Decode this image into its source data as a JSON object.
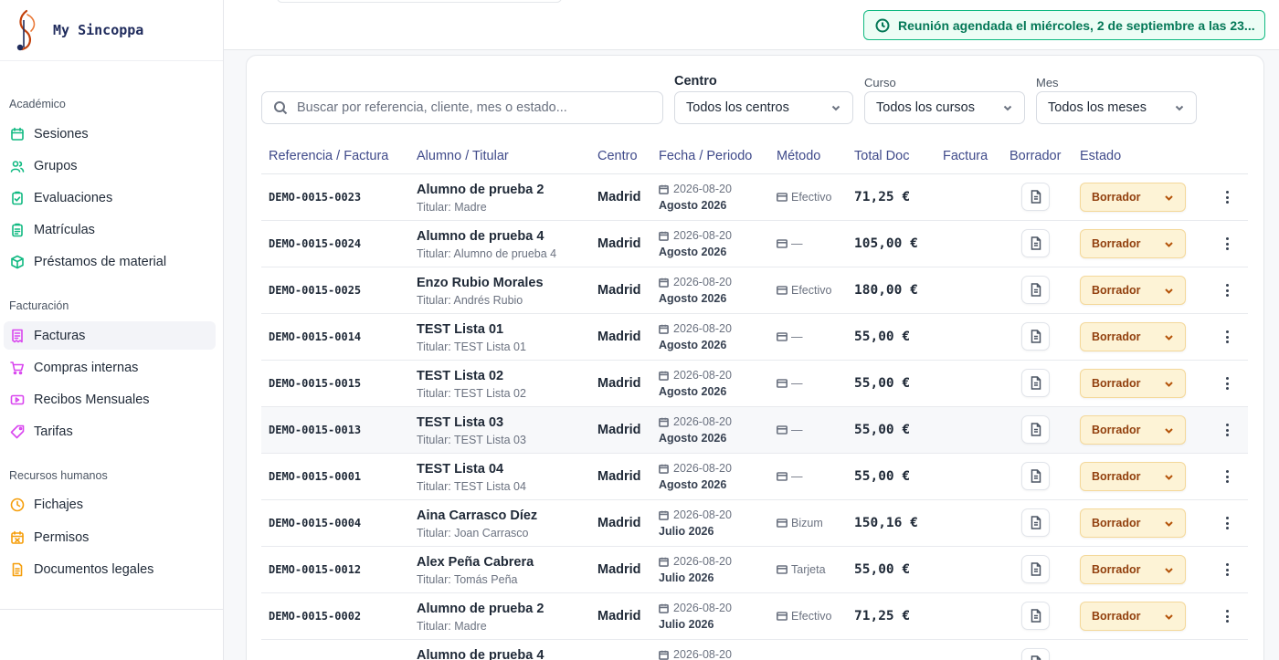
{
  "app": {
    "name": "My Sincoppa"
  },
  "sidebar": {
    "sections": [
      {
        "title": "Académico",
        "items": [
          {
            "label": "Sesiones",
            "icon": "calendar-icon",
            "color": "#10b981"
          },
          {
            "label": "Grupos",
            "icon": "users-icon",
            "color": "#10b981"
          },
          {
            "label": "Evaluaciones",
            "icon": "clipboard-check-icon",
            "color": "#10b981"
          },
          {
            "label": "Matrículas",
            "icon": "clipboard-list-icon",
            "color": "#10b981"
          },
          {
            "label": "Préstamos de material",
            "icon": "package-icon",
            "color": "#10b981"
          }
        ]
      },
      {
        "title": "Facturación",
        "items": [
          {
            "label": "Facturas",
            "icon": "invoice-icon",
            "color": "#d946ef",
            "active": true
          },
          {
            "label": "Compras internas",
            "icon": "cart-icon",
            "color": "#d946ef"
          },
          {
            "label": "Recibos Mensuales",
            "icon": "receipt-icon",
            "color": "#d946ef"
          },
          {
            "label": "Tarifas",
            "icon": "tag-icon",
            "color": "#d946ef"
          }
        ]
      },
      {
        "title": "Recursos humanos",
        "items": [
          {
            "label": "Fichajes",
            "icon": "clock-icon",
            "color": "#f59e0b"
          },
          {
            "label": "Permisos",
            "icon": "calendar-x-icon",
            "color": "#f59e0b"
          },
          {
            "label": "Documentos legales",
            "icon": "document-icon",
            "color": "#f59e0b"
          }
        ]
      }
    ]
  },
  "notice": {
    "text": "Reunión agendada el miércoles, 2 de septiembre a las 23...",
    "color": "#047857"
  },
  "filters": {
    "search_placeholder": "Buscar por referencia, cliente, mes o estado...",
    "centro": {
      "label": "Centro",
      "value": "Todos los centros"
    },
    "curso": {
      "label": "Curso",
      "value": "Todos los cursos"
    },
    "mes": {
      "label": "Mes",
      "value": "Todos los meses"
    }
  },
  "table": {
    "columns": [
      "Referencia / Factura",
      "Alumno / Titular",
      "Centro",
      "Fecha / Periodo",
      "Método",
      "Total Doc",
      "Factura",
      "Borrador",
      "Estado"
    ],
    "rows": [
      {
        "ref": "DEMO-0015-0023",
        "name": "Alumno de prueba 2",
        "titular": "Titular: Madre",
        "centro": "Madrid",
        "fecha": "2026-08-20",
        "periodo": "Agosto 2026",
        "metodo": "Efectivo",
        "total": "71,25 €",
        "estado": "Borrador"
      },
      {
        "ref": "DEMO-0015-0024",
        "name": "Alumno de prueba 4",
        "titular": "Titular: Alumno de prueba 4",
        "centro": "Madrid",
        "fecha": "2026-08-20",
        "periodo": "Agosto 2026",
        "metodo": "—",
        "total": "105,00 €",
        "estado": "Borrador"
      },
      {
        "ref": "DEMO-0015-0025",
        "name": "Enzo Rubio Morales",
        "titular": "Titular: Andrés Rubio",
        "centro": "Madrid",
        "fecha": "2026-08-20",
        "periodo": "Agosto 2026",
        "metodo": "Efectivo",
        "total": "180,00 €",
        "estado": "Borrador"
      },
      {
        "ref": "DEMO-0015-0014",
        "name": "TEST Lista 01",
        "titular": "Titular: TEST Lista 01",
        "centro": "Madrid",
        "fecha": "2026-08-20",
        "periodo": "Agosto 2026",
        "metodo": "—",
        "total": "55,00 €",
        "estado": "Borrador"
      },
      {
        "ref": "DEMO-0015-0015",
        "name": "TEST Lista 02",
        "titular": "Titular: TEST Lista 02",
        "centro": "Madrid",
        "fecha": "2026-08-20",
        "periodo": "Agosto 2026",
        "metodo": "—",
        "total": "55,00 €",
        "estado": "Borrador"
      },
      {
        "ref": "DEMO-0015-0013",
        "name": "TEST Lista 03",
        "titular": "Titular: TEST Lista 03",
        "centro": "Madrid",
        "fecha": "2026-08-20",
        "periodo": "Agosto 2026",
        "metodo": "—",
        "total": "55,00 €",
        "estado": "Borrador",
        "highlight": true
      },
      {
        "ref": "DEMO-0015-0001",
        "name": "TEST Lista 04",
        "titular": "Titular: TEST Lista 04",
        "centro": "Madrid",
        "fecha": "2026-08-20",
        "periodo": "Agosto 2026",
        "metodo": "—",
        "total": "55,00 €",
        "estado": "Borrador"
      },
      {
        "ref": "DEMO-0015-0004",
        "name": "Aina Carrasco Díez",
        "titular": "Titular: Joan Carrasco",
        "centro": "Madrid",
        "fecha": "2026-08-20",
        "periodo": "Julio 2026",
        "metodo": "Bizum",
        "total": "150,16 €",
        "estado": "Borrador"
      },
      {
        "ref": "DEMO-0015-0012",
        "name": "Alex Peña Cabrera",
        "titular": "Titular: Tomás Peña",
        "centro": "Madrid",
        "fecha": "2026-08-20",
        "periodo": "Julio 2026",
        "metodo": "Tarjeta",
        "total": "55,00 €",
        "estado": "Borrador"
      },
      {
        "ref": "DEMO-0015-0002",
        "name": "Alumno de prueba 2",
        "titular": "Titular: Madre",
        "centro": "Madrid",
        "fecha": "2026-08-20",
        "periodo": "Julio 2026",
        "metodo": "Efectivo",
        "total": "71,25 €",
        "estado": "Borrador"
      },
      {
        "ref": "",
        "name": "Alumno de prueba 4",
        "titular": "",
        "centro": "",
        "fecha": "2026-08-20",
        "periodo": "",
        "metodo": "",
        "total": "",
        "estado": ""
      }
    ]
  },
  "colors": {
    "accent": "#3f4a8a",
    "draft_bg": "#fdf3d6",
    "draft_text": "#92400e",
    "success": "#10b981"
  }
}
